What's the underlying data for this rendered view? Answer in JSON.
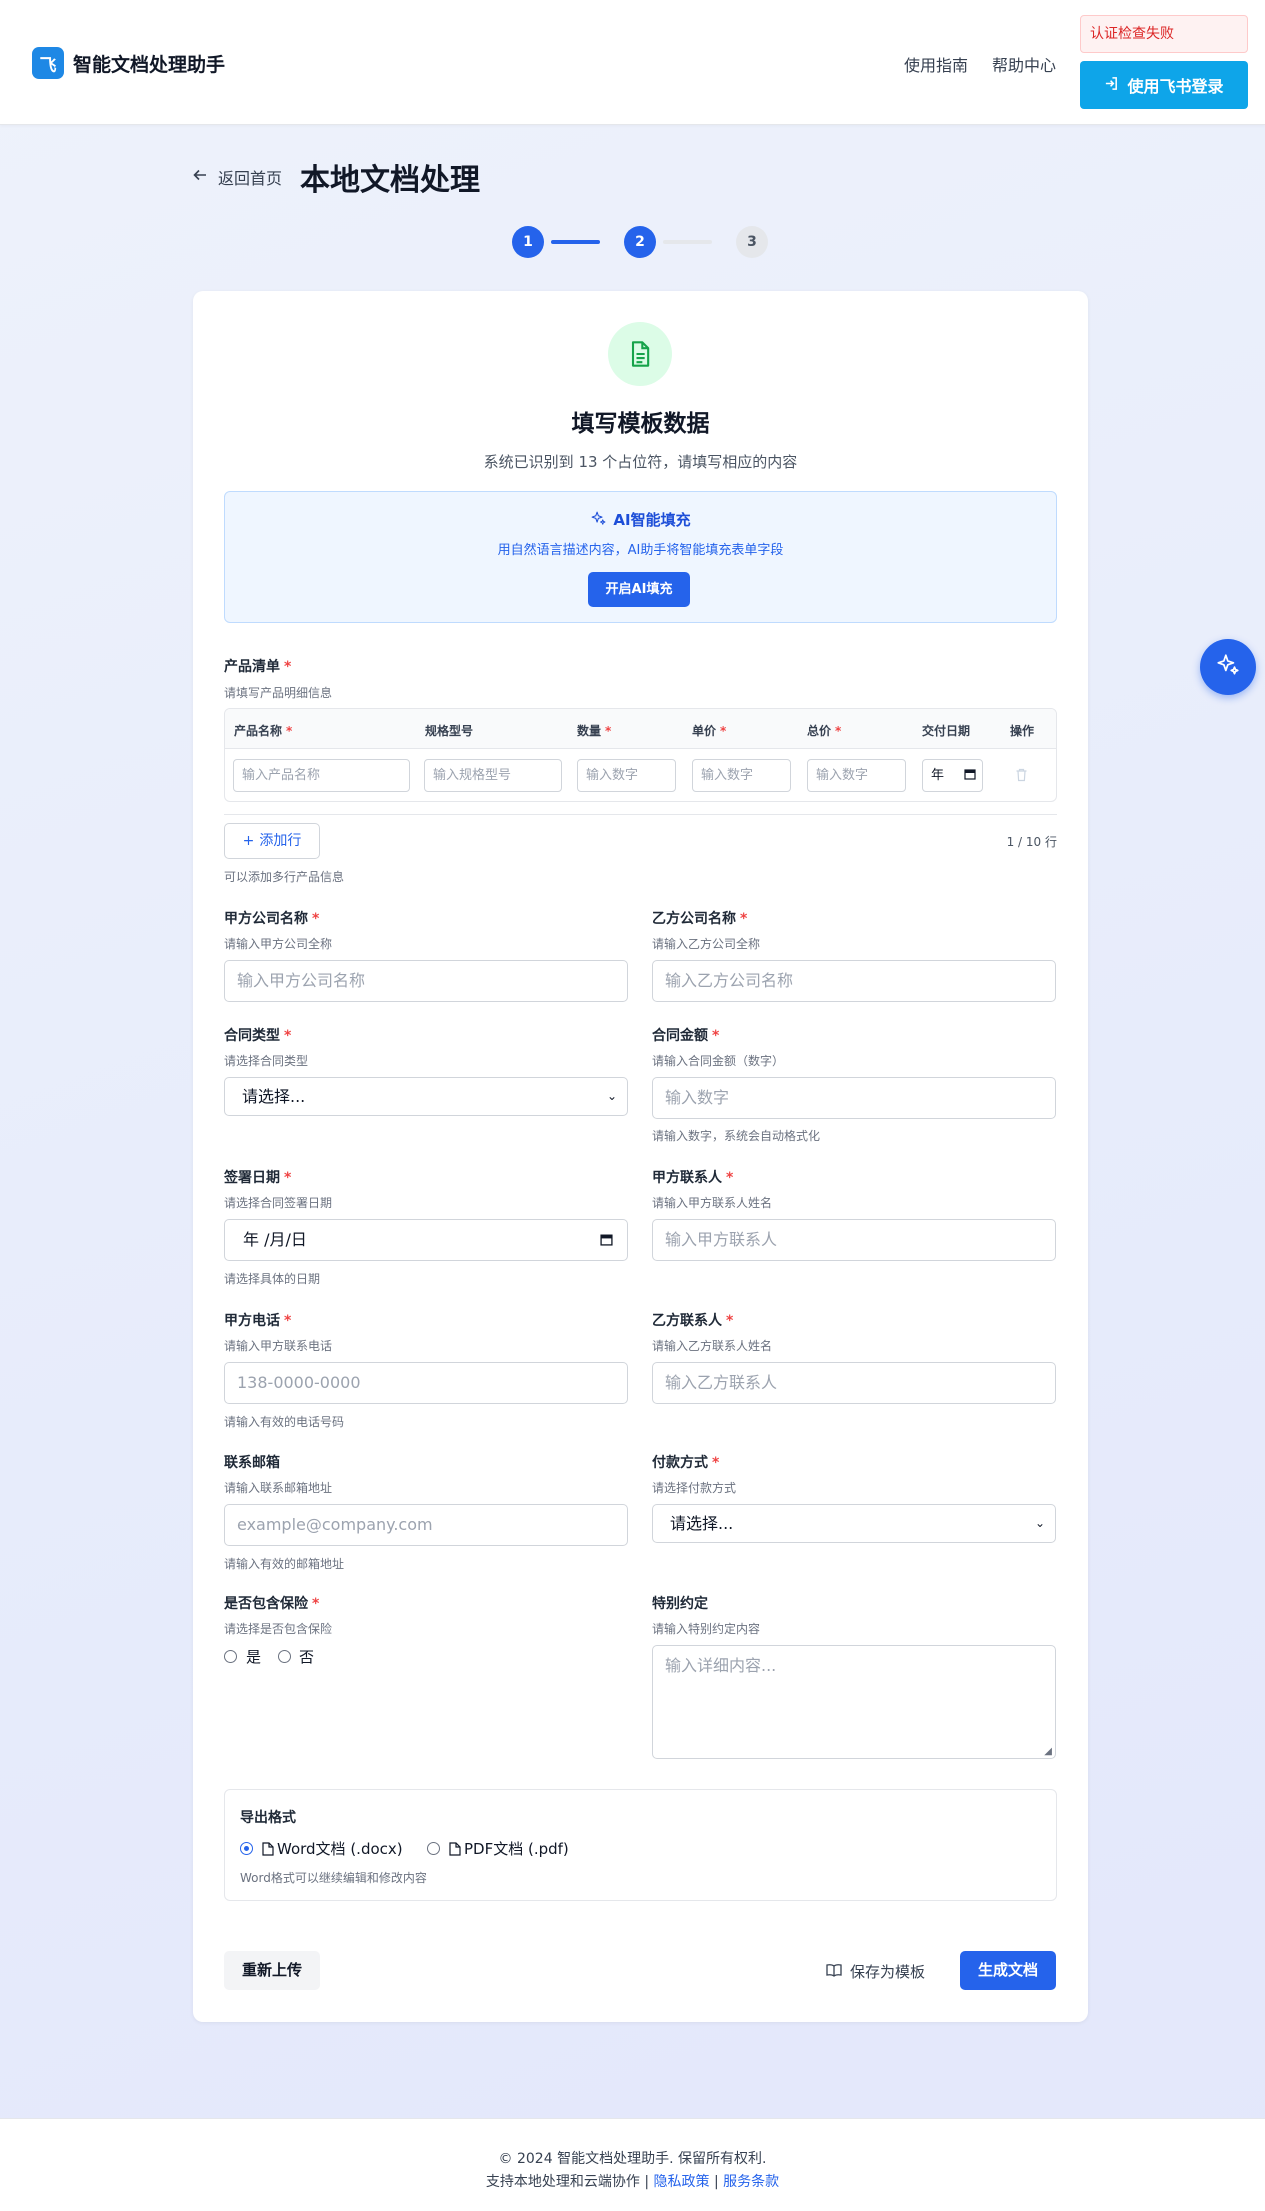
{
  "header": {
    "logo_glyph": "飞",
    "app_title": "智能文档处理助手",
    "nav": [
      "使用指南",
      "帮助中心"
    ],
    "auth_error": "认证检查失败",
    "login_button": "使用飞书登录"
  },
  "page": {
    "back_label": "返回首页",
    "title": "本地文档处理",
    "steps": [
      "1",
      "2",
      "3"
    ],
    "current_step": 2
  },
  "card": {
    "title": "填写模板数据",
    "subtitle": "系统已识别到 13 个占位符，请填写相应的内容",
    "ai": {
      "title": "AI智能填充",
      "description": "用自然语言描述内容，AI助手将智能填充表单字段",
      "button": "开启AI填充"
    },
    "product_list": {
      "label": "产品清单",
      "hint": "请填写产品明细信息",
      "columns": [
        {
          "label": "产品名称",
          "required": true
        },
        {
          "label": "规格型号",
          "required": false
        },
        {
          "label": "数量",
          "required": true
        },
        {
          "label": "单价",
          "required": true
        },
        {
          "label": "总价",
          "required": true
        },
        {
          "label": "交付日期",
          "required": false
        },
        {
          "label": "操作",
          "required": false
        }
      ],
      "row_placeholders": [
        "输入产品名称",
        "输入规格型号",
        "输入数字",
        "输入数字",
        "输入数字",
        "年"
      ],
      "add_row": "添加行",
      "row_count": "1 / 10 行",
      "add_hint": "可以添加多行产品信息"
    },
    "fields": {
      "party_a": {
        "label": "甲方公司名称",
        "hint": "请输入甲方公司全称",
        "placeholder": "输入甲方公司名称"
      },
      "party_b": {
        "label": "乙方公司名称",
        "hint": "请输入乙方公司全称",
        "placeholder": "输入乙方公司名称"
      },
      "contract_type": {
        "label": "合同类型",
        "hint": "请选择合同类型",
        "value": "请选择..."
      },
      "amount": {
        "label": "合同金额",
        "hint": "请输入合同金额（数字）",
        "placeholder": "输入数字",
        "note": "请输入数字，系统会自动格式化"
      },
      "sign_date": {
        "label": "签署日期",
        "hint": "请选择合同签署日期",
        "value": "年 /月/日",
        "note": "请选择具体的日期"
      },
      "contact_a": {
        "label": "甲方联系人",
        "hint": "请输入甲方联系人姓名",
        "placeholder": "输入甲方联系人"
      },
      "phone_a": {
        "label": "甲方电话",
        "hint": "请输入甲方联系电话",
        "placeholder": "138-0000-0000",
        "note": "请输入有效的电话号码"
      },
      "contact_b": {
        "label": "乙方联系人",
        "hint": "请输入乙方联系人姓名",
        "placeholder": "输入乙方联系人"
      },
      "email": {
        "label": "联系邮箱",
        "hint": "请输入联系邮箱地址",
        "placeholder": "example@company.com",
        "note": "请输入有效的邮箱地址"
      },
      "payment": {
        "label": "付款方式",
        "hint": "请选择付款方式",
        "value": "请选择..."
      },
      "insurance": {
        "label": "是否包含保险",
        "hint": "请选择是否包含保险",
        "options": [
          "是",
          "否"
        ]
      },
      "special": {
        "label": "特别约定",
        "hint": "请输入特别约定内容",
        "placeholder": "输入详细内容..."
      }
    },
    "export": {
      "label": "导出格式",
      "options": [
        "Word文档 (.docx)",
        "PDF文档 (.pdf)"
      ],
      "selected": "Word文档 (.docx)",
      "note": "Word格式可以继续编辑和修改内容"
    },
    "actions": {
      "reupload": "重新上传",
      "save_template": "保存为模板",
      "generate": "生成文档"
    }
  },
  "footer": {
    "copyright": "© 2024 智能文档处理助手. 保留所有权利.",
    "line2_prefix": "支持本地处理和云端协作",
    "privacy": "隐私政策",
    "terms": "服务条款",
    "separator": "|"
  },
  "colors": {
    "primary": "#2563eb",
    "login": "#0ea5e9",
    "required": "#ef4444",
    "error_bg": "#fef2f2"
  }
}
